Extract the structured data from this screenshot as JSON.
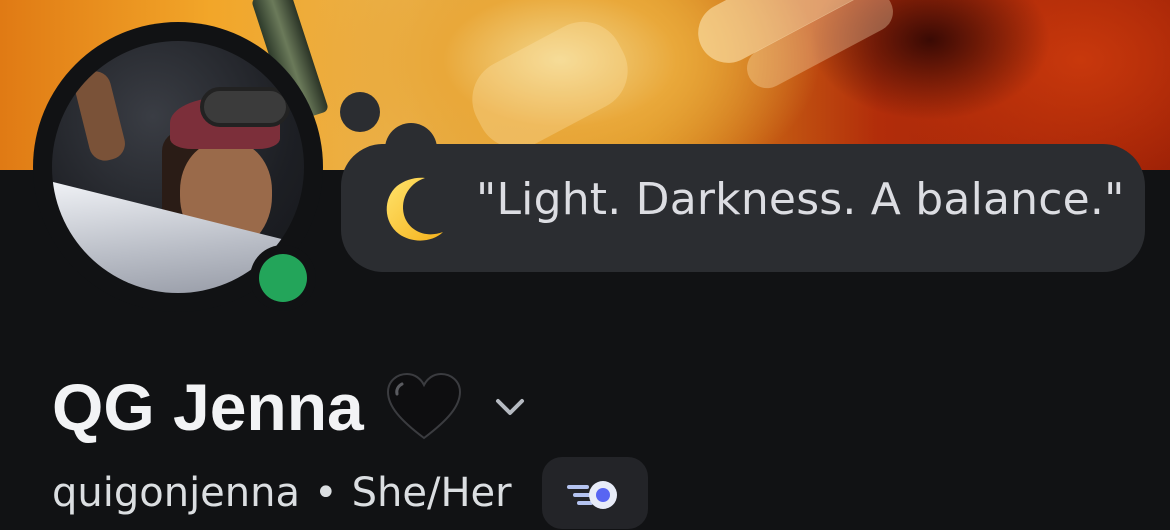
{
  "profile": {
    "custom_status": {
      "emoji": "crescent-moon",
      "text": "\"Light. Darkness. A balance.\""
    },
    "display_name": "QG Jenna",
    "name_emoji": "black-heart",
    "username": "quigonjenna",
    "separator": "•",
    "pronouns": "She/Her",
    "online_status": "online",
    "badges": [
      "nitro-badge"
    ]
  },
  "colors": {
    "background": "#111214",
    "bubble": "#2b2d31",
    "online": "#23a55a",
    "text_primary": "#f2f3f5",
    "text_secondary": "#dbdee1"
  }
}
